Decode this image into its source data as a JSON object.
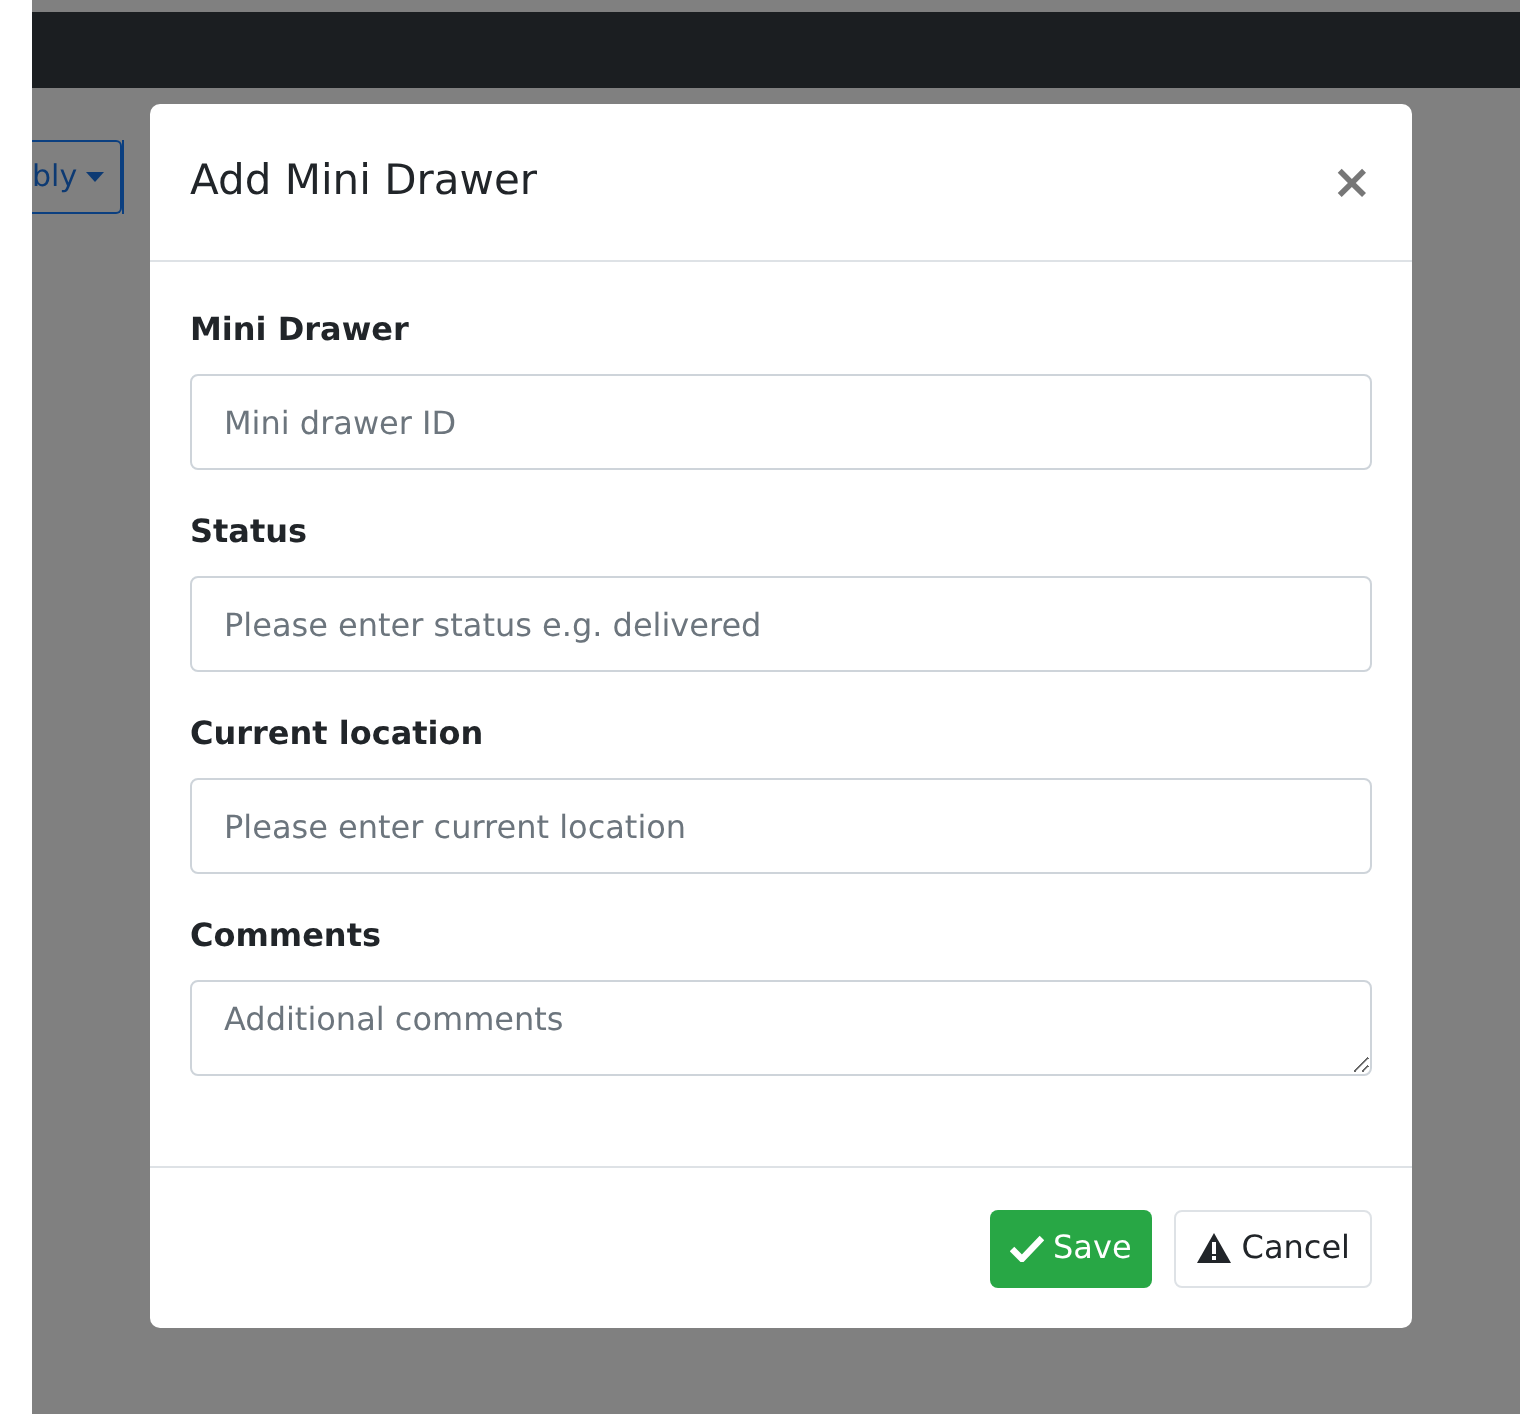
{
  "background": {
    "dropdown_label": "bly"
  },
  "modal": {
    "title": "Add Mini Drawer",
    "close": "×",
    "fields": [
      {
        "kind": "input",
        "label": "Mini Drawer",
        "placeholder": "Mini drawer ID"
      },
      {
        "kind": "input",
        "label": "Status",
        "placeholder": "Please enter status e.g. delivered"
      },
      {
        "kind": "input",
        "label": "Current location",
        "placeholder": "Please enter current location"
      },
      {
        "kind": "textarea",
        "label": "Comments",
        "placeholder": "Additional comments"
      }
    ],
    "buttons": [
      {
        "kind": "primary",
        "label": "Save"
      },
      {
        "kind": "secondary",
        "label": "Cancel"
      }
    ]
  }
}
